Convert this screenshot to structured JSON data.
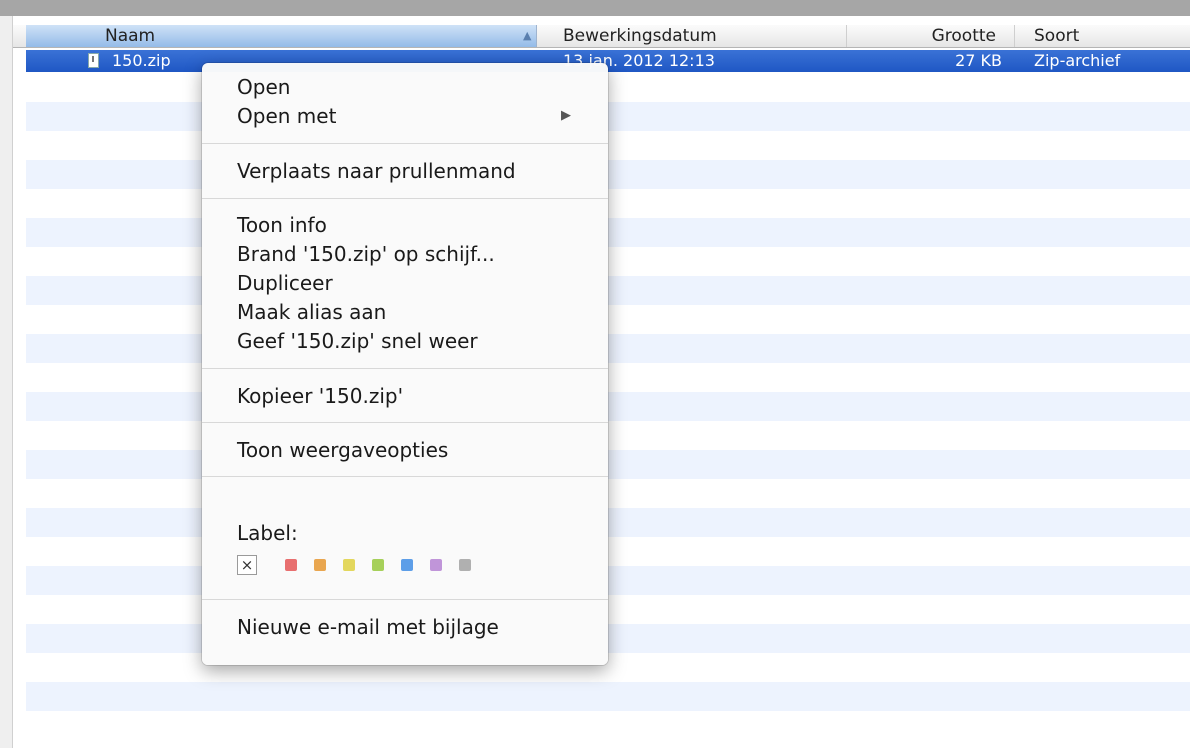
{
  "columns": {
    "name": "Naam",
    "date": "Bewerkingsdatum",
    "size": "Grootte",
    "kind": "Soort"
  },
  "file": {
    "name": "150.zip",
    "date": "13 jan. 2012 12:13",
    "size": "27 KB",
    "kind": "Zip-archief"
  },
  "context_menu": {
    "open": "Open",
    "open_with": "Open met",
    "move_to_trash": "Verplaats naar prullenmand",
    "get_info": "Toon info",
    "burn": "Brand '150.zip' op schijf...",
    "duplicate": "Dupliceer",
    "make_alias": "Maak alias aan",
    "quick_look": "Geef '150.zip' snel weer",
    "copy": "Kopieer '150.zip'",
    "view_options": "Toon weergaveopties",
    "label_title": "Label:",
    "label_none": "×",
    "new_email": "Nieuwe e-mail met bijlage"
  },
  "label_colors": [
    "#e86f6f",
    "#e9a64f",
    "#e3d75d",
    "#a6d05a",
    "#5d9ee8",
    "#c095d9",
    "#b0b0b0"
  ],
  "colors": {
    "selection": "#1f57c4",
    "stripe": "#edf3fe"
  }
}
